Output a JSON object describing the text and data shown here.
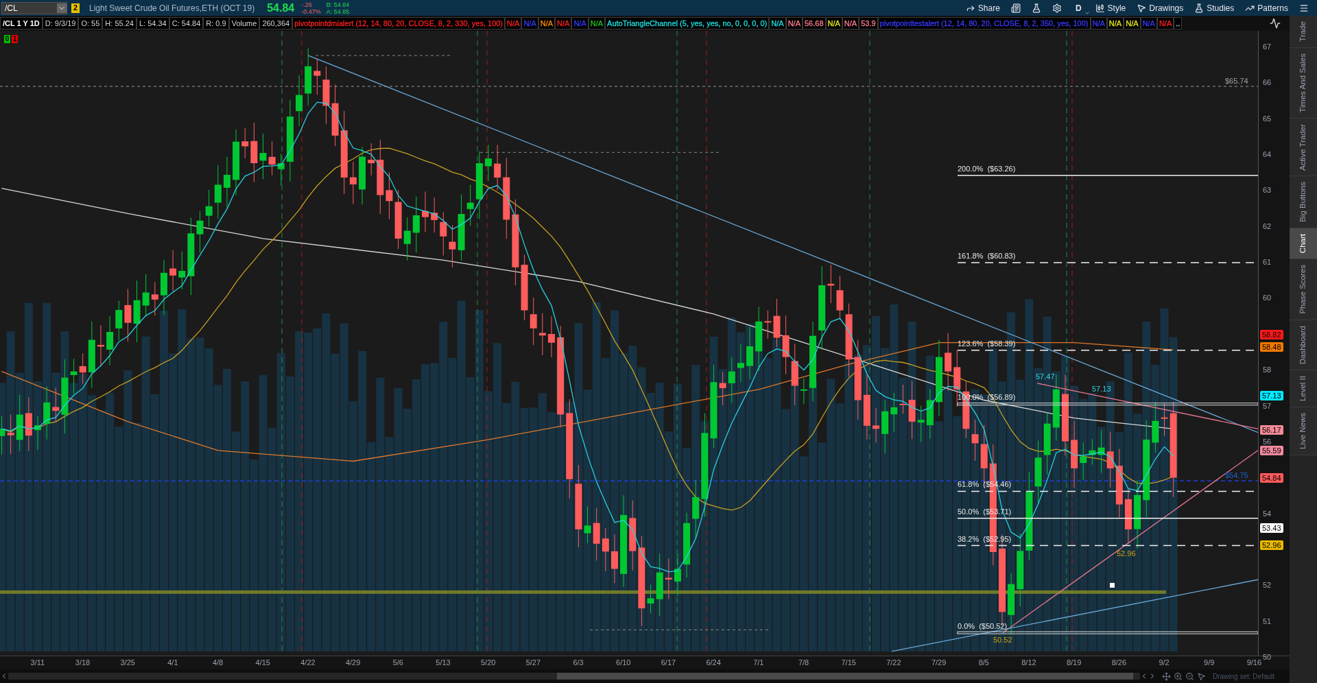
{
  "symbol": {
    "value": "/CL"
  },
  "link_badge": "2",
  "instrument": "Light Sweet Crude Oil Futures,ETH (OCT 19)",
  "quote": {
    "last": "54.84",
    "change": "-.26",
    "change_pct": "-0.47%",
    "bid": "B: 54.84",
    "ask": "A: 54.85"
  },
  "toolbar": [
    {
      "kind": "labeled",
      "label": "Share"
    },
    {
      "kind": "icon"
    },
    {
      "kind": "icon"
    },
    {
      "kind": "icon"
    },
    {
      "kind": "menu",
      "label": "D"
    },
    {
      "kind": "labeled",
      "label": "Style"
    },
    {
      "kind": "labeled",
      "label": "Drawings"
    },
    {
      "kind": "labeled",
      "label": "Studies"
    },
    {
      "kind": "labeled",
      "label": "Patterns"
    },
    {
      "kind": "icon"
    }
  ],
  "header_fields": [
    "/CL 1 Y 1D",
    "D: 9/3/19",
    "O: 55",
    "H: 55.24",
    "L: 54.34",
    "C: 54.84",
    "R: 0.9",
    "Volume",
    "260,364"
  ],
  "studies": [
    {
      "text": "pivotpointdmialert (12, 14, 80, 20, CLOSE, 8, 2, 330, yes, 100)",
      "color": "#ff2020"
    },
    {
      "text": "N/A",
      "color": "#ff2020"
    },
    {
      "text": "N/A",
      "color": "#3a3aff"
    },
    {
      "text": "N/A",
      "color": "#ff8c00"
    },
    {
      "text": "N/A",
      "color": "#ff2020"
    },
    {
      "text": "N/A",
      "color": "#3a3aff"
    },
    {
      "text": "N/A",
      "color": "#20c020"
    },
    {
      "text": "AutoTriangleChannel (5, yes, yes, no, 0, 0, 0, 0)",
      "color": "#20e0e0"
    },
    {
      "text": "N/A",
      "color": "#20e0e0"
    },
    {
      "text": "N/A",
      "color": "#ff7f8f"
    },
    {
      "text": "56.68",
      "color": "#ff7f8f"
    },
    {
      "text": "N/A",
      "color": "#e6e620"
    },
    {
      "text": "N/A",
      "color": "#ff7f8f"
    },
    {
      "text": "53.9",
      "color": "#ff7f8f"
    },
    {
      "text": "pivotpointtestalert (12, 14, 80, 20, CLOSE, 8, 2, 350, yes, 100)",
      "color": "#3a3aff"
    },
    {
      "text": "N/A",
      "color": "#3a3aff"
    },
    {
      "text": "N/A",
      "color": "#e6e620"
    },
    {
      "text": "N/A",
      "color": "#e6e620"
    },
    {
      "text": "N/A",
      "color": "#3a3aff"
    },
    {
      "text": "N/A",
      "color": "#ff2020"
    },
    {
      "text": ".."
    }
  ],
  "signals": [
    {
      "text": "0",
      "color": "#00c000"
    },
    {
      "text": "1",
      "color": "#e00000"
    }
  ],
  "price_axis": [
    "67",
    "66",
    "65",
    "64",
    "63",
    "62",
    "61",
    "60",
    "58",
    "57",
    "56",
    "54",
    "52",
    "51",
    "50"
  ],
  "price_badges": [
    {
      "value": "58.82",
      "color": "#ff1a1a"
    },
    {
      "value": "58.48",
      "color": "#f07800"
    },
    {
      "value": "57.13",
      "color": "#00e8ff"
    },
    {
      "value": "56.17",
      "color": "#f28a96"
    },
    {
      "value": "55.59",
      "color": "#f28a9e"
    },
    {
      "value": "54.84",
      "color": "#ff5a5a"
    },
    {
      "value": "53.43",
      "color": "#ffffff"
    },
    {
      "value": "52.96",
      "color": "#e8b800"
    }
  ],
  "fibonacci": [
    {
      "label": "200.0%  ($63.26)",
      "kind": "solid"
    },
    {
      "label": "161.8%  ($60.83)",
      "kind": "dashed"
    },
    {
      "label": "123.6%  ($58.39)",
      "kind": "dashed"
    },
    {
      "label": "100.0%  ($56.89)",
      "kind": "double"
    },
    {
      "label": "61.8%  ($54.46)",
      "kind": "dashed"
    },
    {
      "label": "50.0%  ($53.71)",
      "kind": "solid"
    },
    {
      "label": "38.2%  ($52.95)",
      "kind": "dashed"
    },
    {
      "label": "0.0%  ($50.52)",
      "kind": "double"
    }
  ],
  "chart_labels": [
    {
      "text": "$65.74",
      "kind": "level"
    },
    {
      "text": "57.47",
      "kind": "high"
    },
    {
      "text": "57.13",
      "kind": "high"
    },
    {
      "text": "$54.75",
      "kind": "bid"
    },
    {
      "text": "52.96",
      "kind": "low"
    },
    {
      "text": "50.52",
      "kind": "low"
    }
  ],
  "date_axis": [
    "3/11",
    "3/18",
    "3/25",
    "4/1",
    "4/8",
    "4/15",
    "4/22",
    "4/29",
    "5/6",
    "5/13",
    "5/20",
    "5/27",
    "6/3",
    "6/10",
    "6/17",
    "6/24",
    "7/1",
    "7/8",
    "7/15",
    "7/22",
    "7/29",
    "8/5",
    "8/12",
    "8/19",
    "8/26",
    "9/2",
    "9/9",
    "9/16"
  ],
  "drawing_set": "Drawing set: Default",
  "sidebar": [
    {
      "label": "Trade",
      "selected": false
    },
    {
      "label": "Times And Sales",
      "selected": false
    },
    {
      "label": "Active Trader",
      "selected": false
    },
    {
      "label": "Big Buttons",
      "selected": false
    },
    {
      "label": "Chart",
      "selected": true
    },
    {
      "label": "Phase Scores",
      "selected": false
    },
    {
      "label": "Dashboard",
      "selected": false
    },
    {
      "label": "Level II",
      "selected": false
    },
    {
      "label": "Live News",
      "selected": false
    }
  ]
}
